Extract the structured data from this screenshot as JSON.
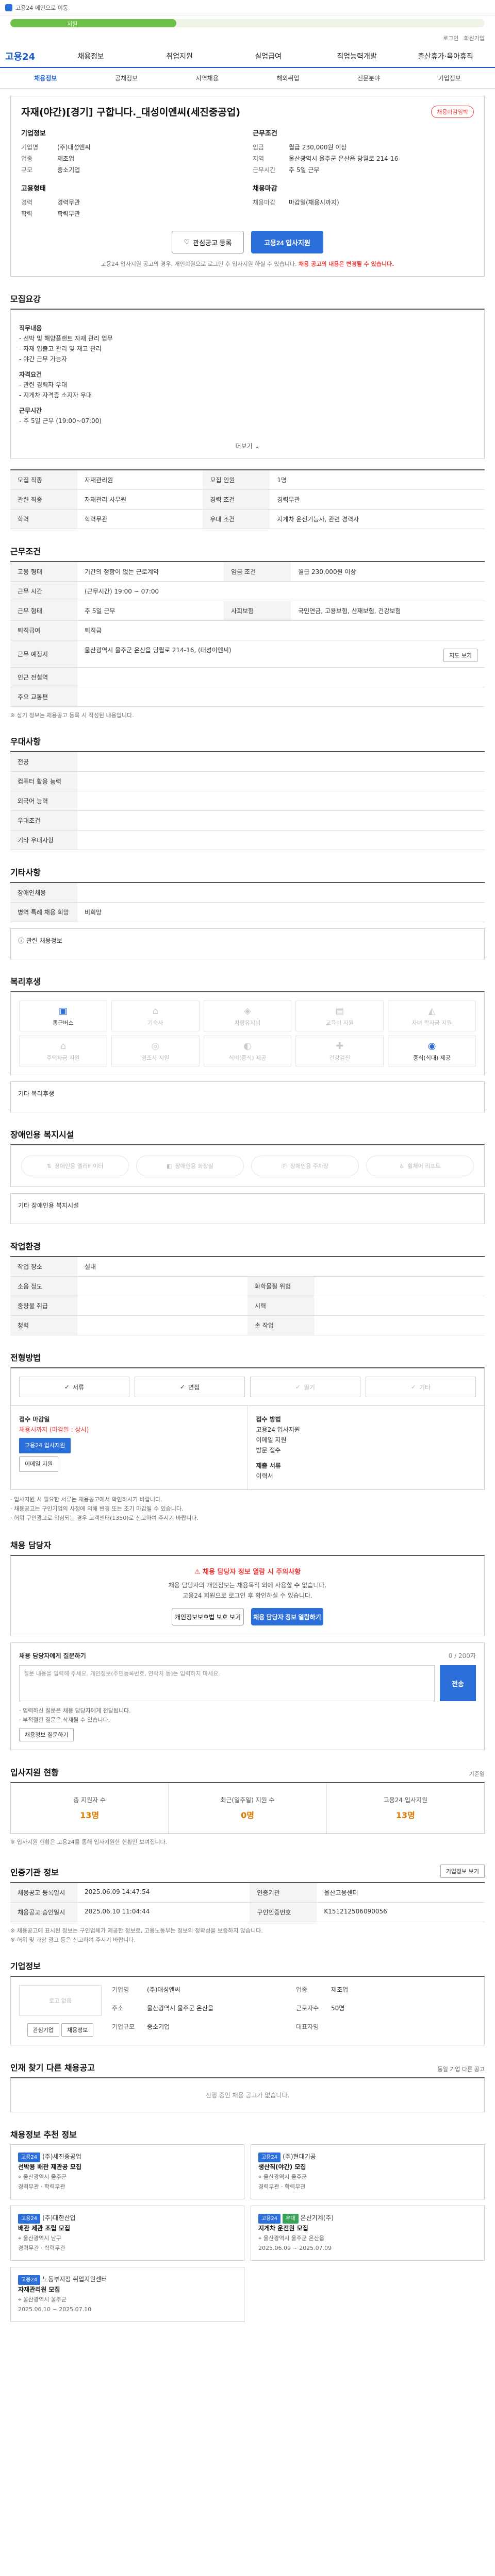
{
  "topbar": {
    "text": "고용24 메인으로 이동"
  },
  "progress": {
    "label": "지원",
    "fraction": 0.35
  },
  "user": {
    "login": "로그인",
    "join": "회원가입"
  },
  "nav": {
    "logo": "고용24",
    "items": [
      "채용정보",
      "취업지원",
      "실업급여",
      "직업능력개발",
      "출산휴가·육아휴직"
    ]
  },
  "subnav": {
    "items": [
      "채용정보",
      "공채정보",
      "지역채용",
      "해외취업",
      "전문분야",
      "기업정보"
    ]
  },
  "job": {
    "title": "자재(야간)[경기] 구합니다._대성이엔씨(세진중공업)",
    "badge": "채용마감임박",
    "company_head": "기업정보",
    "company_rows": [
      {
        "k": "기업명",
        "v": "(주)대성엔씨"
      },
      {
        "k": "업종",
        "v": "제조업"
      },
      {
        "k": "규모",
        "v": "중소기업"
      }
    ],
    "cond_head": "근무조건",
    "cond_rows": [
      {
        "k": "임금",
        "v": "월급 230,000원 이상"
      },
      {
        "k": "지역",
        "v": "울산광역시 울주군 온산읍 당월로 214-16"
      },
      {
        "k": "근무시간",
        "v": "주 5일 근무"
      }
    ],
    "req_head": "고용형태",
    "req_rows": [
      {
        "k": "경력",
        "v": "경력무관"
      },
      {
        "k": "학력",
        "v": "학력무관"
      }
    ],
    "deadline_head": "채용마감",
    "deadline_rows": [
      {
        "k": "채용마감",
        "v": "마감일(채용시까지)"
      }
    ],
    "btn_scrap": "관심공고 등록",
    "btn_apply": "고용24 입사지원",
    "notice": "고용24 입사지원 공고의 경우, 개인회원으로 로그인 후 입사지원 하실 수 있습니다.",
    "notice_strong": "채용 공고의 내용은 변경될 수 있습니다."
  },
  "recruit": {
    "title": "모집요강",
    "desc_lines": [
      "직무내용",
      "- 선박 및 해양플랜트 자재 관리 업무",
      "- 자재 입출고 관리 및 재고 관리",
      "- 야간 근무 가능자",
      "자격요건",
      "- 관련 경력자 우대",
      "- 지게차 자격증 소지자 우대",
      "근무시간",
      "- 주 5일 근무 (19:00~07:00)"
    ],
    "more": "더보기",
    "rows": [
      {
        "k": "모집 직종",
        "v": "자재관리원"
      },
      {
        "k": "모집 인원",
        "v": "1명"
      },
      {
        "k": "관련 직종",
        "v": "자재관리 사무원"
      },
      {
        "k": "경력 조건",
        "v": "경력무관"
      },
      {
        "k": "학력",
        "v": "학력무관"
      },
      {
        "k": "우대 조건",
        "v": "지게차 운전기능사, 관련 경력자"
      }
    ]
  },
  "work": {
    "title": "근무조건",
    "rows": [
      {
        "k": "고용 형태",
        "v": "기간의 정함이 없는 근로계약"
      },
      {
        "k": "임금 조건",
        "v": "월급 230,000원 이상"
      },
      {
        "k": "근무 시간",
        "v": "(근무시간) 19:00 ~ 07:00"
      },
      {
        "k": "근무 형태",
        "v": "주 5일 근무"
      },
      {
        "k": "사회보험",
        "v": "국민연금, 고용보험, 산재보험, 건강보험"
      },
      {
        "k": "퇴직급여",
        "v": "퇴직금"
      },
      {
        "k": "근무 예정지",
        "v": "울산광역시 울주군 온산읍 당월로 214-16, (대성이엔씨)"
      },
      {
        "k": "인근 전철역",
        "v": ""
      },
      {
        "k": "주요 교통편",
        "v": ""
      }
    ],
    "map_btn": "지도 보기",
    "note": "※ 상기 정보는 채용공고 등록 시 작성된 내용입니다."
  },
  "extra": {
    "title": "우대사항",
    "rows": [
      {
        "k": "전공",
        "v": ""
      },
      {
        "k": "컴퓨터 활용 능력",
        "v": ""
      },
      {
        "k": "외국어 능력",
        "v": ""
      },
      {
        "k": "우대조건",
        "v": ""
      },
      {
        "k": "기타 우대사항",
        "v": ""
      }
    ]
  },
  "other": {
    "title": "기타사항",
    "rows": [
      {
        "k": "장애인채용",
        "v": ""
      },
      {
        "k": "병역 특례 채용 희망",
        "v": "비희망"
      }
    ],
    "link": "관련 채용정보"
  },
  "welfare": {
    "title": "복리후생",
    "items": [
      {
        "label": "통근버스",
        "on": true
      },
      {
        "label": "기숙사",
        "on": false
      },
      {
        "label": "차량유지비",
        "on": false
      },
      {
        "label": "교육비 지원",
        "on": false
      },
      {
        "label": "자녀 학자금 지원",
        "on": false
      },
      {
        "label": "주택자금 지원",
        "on": false
      },
      {
        "label": "경조사 지원",
        "on": false
      },
      {
        "label": "식비(중식) 제공",
        "on": false
      },
      {
        "label": "건강검진",
        "on": false
      },
      {
        "label": "중식(식대) 제공",
        "on": true
      }
    ],
    "etc_label": "기타 복리후생"
  },
  "disability": {
    "title": "장애인용 복지시설",
    "items": [
      "장애인용 엘리베이터",
      "장애인용 화장실",
      "장애인용 주차장",
      "휠체어 리프트"
    ],
    "etc_label": "기타 장애인용 복지시설"
  },
  "env": {
    "title": "작업환경",
    "rows": [
      {
        "k": "작업 장소",
        "v": "실내",
        "k2": "",
        "v2": ""
      },
      {
        "k": "소음 정도",
        "v": "",
        "k2": "화학물질 위험",
        "v2": ""
      },
      {
        "k": "중량물 취급",
        "v": "",
        "k2": "시력",
        "v2": ""
      },
      {
        "k": "청력",
        "v": "",
        "k2": "손 작업",
        "v2": ""
      }
    ]
  },
  "apply": {
    "title": "전형방법",
    "tabs": [
      {
        "label": "서류",
        "dim": false
      },
      {
        "label": "면접",
        "dim": false
      },
      {
        "label": "필기",
        "dim": true
      },
      {
        "label": "기타",
        "dim": true
      }
    ],
    "left_title": "접수 마감일",
    "left_value": "채용시까지 (마감일 : 상시)",
    "left_btn1": "고용24 입사지원",
    "left_btn2": "이메일 지원",
    "right_title": "접수 방법",
    "right_lines": [
      "고용24 입사지원",
      "이메일 지원",
      "방문 접수"
    ],
    "right_docs_title": "제출 서류",
    "right_docs": "이력서",
    "bullets": [
      "· 입사지원 시 필요한 서류는 채용공고에서 확인하시기 바랍니다.",
      "· 채용공고는 구인기업의 사정에 의해 변경 또는 조기 마감될 수 있습니다.",
      "· 허위 구인광고로 의심되는 경우 고객센터(1350)로 신고하여 주시기 바랍니다."
    ]
  },
  "manager": {
    "title": "채용 담당자",
    "warn": "채용 담당자 정보 열람 시 주의사항",
    "lines": [
      "채용 담당자의 개인정보는 채용목적 외에 사용할 수 없습니다.",
      "고용24 회원으로 로그인 후 확인하실 수 있습니다."
    ],
    "btn1": "개인정보보호법 보호 보기",
    "btn2": "채용 담당자 정보 열람하기"
  },
  "question": {
    "title": "채용 담당자에게 질문하기",
    "counter": "0 / 200자",
    "placeholder": "질문 내용을 입력해 주세요. 개인정보(주민등록번호, 연락처 등)는 입력하지 마세요.",
    "send": "전송",
    "notes": [
      "· 입력하신 질문은 채용 담당자에게 전달됩니다.",
      "· 부적절한 질문은 삭제될 수 있습니다."
    ],
    "btn_more": "채용정보 질문하기"
  },
  "stats": {
    "title": "입사지원 현황",
    "aux": "기준일",
    "items": [
      {
        "label": "총 지원자 수",
        "value": "13명"
      },
      {
        "label": "최근(일주일) 지원 수",
        "value": "0명"
      },
      {
        "label": "고용24 입사지원",
        "value": "13명"
      }
    ],
    "note": "※ 입사지원 현황은 고용24를 통해 입사지원한 현황만 보여집니다."
  },
  "org": {
    "title": "인증기관 정보",
    "btn": "기업정보 보기",
    "rows": [
      {
        "k": "채용공고 등록일시",
        "v": "2025.06.09 14:47:54",
        "k2": "인증기관",
        "v2": "울산고용센터"
      },
      {
        "k": "채용공고 승인일시",
        "v": "2025.06.10 11:04:44",
        "k2": "구인인증번호",
        "v2": "K151212506090056"
      }
    ],
    "notes": [
      "※ 채용공고에 표시된 정보는 구인업체가 제공한 정보로, 고용노동부는 정보의 정확성을 보증하지 않습니다.",
      "※ 허위 및 과장 광고 등은 신고하여 주시기 바랍니다."
    ]
  },
  "company": {
    "title": "기업정보",
    "logo": "로고 없음",
    "btn1": "관심기업",
    "btn2": "채용정보",
    "rows": [
      {
        "k": "기업명",
        "v": "(주)대성엔씨",
        "k2": "업종",
        "v2": "제조업"
      },
      {
        "k": "주소",
        "v": "울산광역시 울주군 온산읍",
        "k2": "근로자수",
        "v2": "50명"
      },
      {
        "k": "기업규모",
        "v": "중소기업",
        "k2": "대표자명",
        "v2": ""
      }
    ]
  },
  "other_jobs": {
    "title": "인재 찾기 다른 채용공고",
    "aux": "동일 기업 다른 공고",
    "empty": "진행 중인 채용 공고가 없습니다."
  },
  "rec": {
    "title": "채용정보 추천 정보",
    "cards": [
      {
        "tag": "고용24",
        "tag2": "",
        "org": "(주)세진중공업",
        "title": "선박용 배관 제관공 모집",
        "d1": "울산광역시 울주군",
        "d2": "경력무관 · 학력무관"
      },
      {
        "tag": "고용24",
        "tag2": "",
        "org": "(주)현대기공",
        "title": "생산직(야간) 모집",
        "d1": "울산광역시 울주군",
        "d2": "경력무관 · 학력무관"
      },
      {
        "tag": "고용24",
        "tag2": "",
        "org": "(주)대한산업",
        "title": "배관 제관 조립 모집",
        "d1": "울산광역시 남구",
        "d2": "경력무관 · 학력무관"
      },
      {
        "tag": "고용24",
        "tag2": "우대",
        "org": "온산기계(주)",
        "title": "지게차 운전원 모집",
        "d1": "울산광역시 울주군 온산읍",
        "d2": "2025.06.09 ~ 2025.07.09"
      },
      {
        "tag": "고용24",
        "tag2": "",
        "org": "노동부지정 취업지원센터",
        "title": "자재관리원 모집",
        "d1": "울산광역시 울주군",
        "d2": "2025.06.10 ~ 2025.07.10"
      }
    ]
  }
}
